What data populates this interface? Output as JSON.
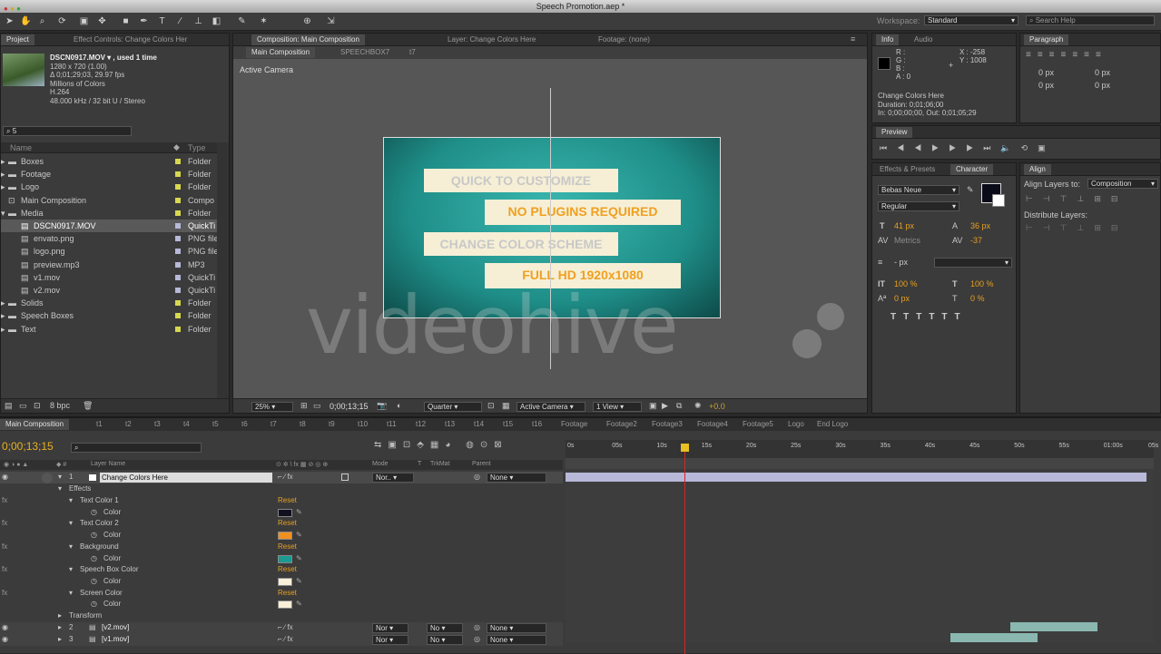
{
  "window": {
    "title": "Speech Promotion.aep *"
  },
  "workspace": {
    "label": "Workspace:",
    "value": "Standard",
    "search_placeholder": "Search Help"
  },
  "project": {
    "tabs": [
      "Project",
      "Effect Controls: Change Colors Her"
    ],
    "footage": {
      "name": "DSCN0917.MOV ▾ , used 1 time",
      "details": [
        "1280 x 720 (1.00)",
        "Δ 0;01;29;03, 29.97 fps",
        "Millions of Colors",
        "H.264",
        "48.000 kHz / 32 bit U / Stereo"
      ]
    },
    "search_value": "5",
    "columns": {
      "name": "Name",
      "type": "Type"
    },
    "items": [
      {
        "name": "Boxes",
        "type": "Folder",
        "icon": "folder",
        "color": "#d8d850",
        "expand": "▸",
        "indent": 0
      },
      {
        "name": "Footage",
        "type": "Folder",
        "icon": "folder",
        "color": "#d8d850",
        "expand": "▸",
        "indent": 0
      },
      {
        "name": "Logo",
        "type": "Folder",
        "icon": "folder",
        "color": "#d8d850",
        "expand": "▸",
        "indent": 0
      },
      {
        "name": "Main Composition",
        "type": "Compo",
        "icon": "comp",
        "color": "#d8d850",
        "expand": "",
        "indent": 0
      },
      {
        "name": "Media",
        "type": "Folder",
        "icon": "folder",
        "color": "#d8d850",
        "expand": "▾",
        "indent": 0
      },
      {
        "name": "DSCN0917.MOV",
        "type": "QuickTi",
        "icon": "file",
        "color": "#b8b8d8",
        "expand": "",
        "indent": 1,
        "selected": true
      },
      {
        "name": "envato.png",
        "type": "PNG file",
        "icon": "file",
        "color": "#b8b8d8",
        "expand": "",
        "indent": 1
      },
      {
        "name": "logo.png",
        "type": "PNG file",
        "icon": "file",
        "color": "#b8b8d8",
        "expand": "",
        "indent": 1
      },
      {
        "name": "preview.mp3",
        "type": "MP3",
        "icon": "file",
        "color": "#b8b8d8",
        "expand": "",
        "indent": 1
      },
      {
        "name": "v1.mov",
        "type": "QuickTi",
        "icon": "file",
        "color": "#b8b8d8",
        "expand": "",
        "indent": 1
      },
      {
        "name": "v2.mov",
        "type": "QuickTi",
        "icon": "file",
        "color": "#b8b8d8",
        "expand": "",
        "indent": 1
      },
      {
        "name": "Solids",
        "type": "Folder",
        "icon": "folder",
        "color": "#d8d850",
        "expand": "▸",
        "indent": 0
      },
      {
        "name": "Speech Boxes",
        "type": "Folder",
        "icon": "folder",
        "color": "#d8d850",
        "expand": "▸",
        "indent": 0
      },
      {
        "name": "Text",
        "type": "Folder",
        "icon": "folder",
        "color": "#d8d850",
        "expand": "▸",
        "indent": 0
      }
    ],
    "bpc": "8 bpc"
  },
  "composition": {
    "tabs": [
      "Composition: Main Composition",
      "Layer: Change Colors Here",
      "Footage: (none)"
    ],
    "breadcrumbs": [
      "Main Composition",
      "SPEECHBOX7",
      "t7"
    ],
    "camera_label": "Active Camera",
    "bubbles": [
      {
        "text": "QUICK TO CUSTOMIZE",
        "color": "#1a1a1a"
      },
      {
        "text": "NO PLUGINS REQUIRED",
        "color": "#f0a020"
      },
      {
        "text": "CHANGE COLOR SCHEME",
        "color": "#1a1a1a"
      },
      {
        "text": "FULL HD 1920x1080",
        "color": "#f0a020"
      }
    ],
    "watermark": "videohive",
    "footer": {
      "zoom": "25%",
      "timecode": "0;00;13;15",
      "resolution": "Quarter",
      "camera": "Active Camera",
      "views": "1 View",
      "exposure": "+0.0"
    }
  },
  "info": {
    "tabs": [
      "Info",
      "Audio"
    ],
    "r": "R :",
    "g": "G :",
    "b": "B :",
    "a": "A : 0",
    "x": "X : -258",
    "y": "Y : 1008",
    "layer": "Change Colors Here",
    "duration": "Duration: 0;01;06;00",
    "in_out": "In: 0;00;00;00, Out: 0;01;05;29"
  },
  "paragraph": {
    "tab": "Paragraph",
    "values": [
      "0 px",
      "0 px",
      "0 px",
      "0 px",
      "0 px"
    ]
  },
  "preview": {
    "tab": "Preview",
    "controls": [
      "⏮",
      "◀◀",
      "▶",
      "▶▶",
      "⏭",
      "🔈",
      "⟲",
      "▣"
    ]
  },
  "character": {
    "tabs": [
      "Effects & Presets",
      "Character"
    ],
    "font": "Bebas Neue",
    "style": "Regular",
    "size": "41 px",
    "leading": "36 px",
    "kerning": "Metrics",
    "tracking": "-37",
    "stroke": "- px",
    "vscale": "100 %",
    "hscale": "100 %",
    "baseline": "0 px",
    "tsume": "0 %",
    "fill_color": "#0a0a18"
  },
  "align": {
    "tab": "Align",
    "label": "Align Layers to:",
    "value": "Composition",
    "distribute": "Distribute Layers:"
  },
  "timeline": {
    "tabs": [
      "Main Composition",
      "t1",
      "t2",
      "t3",
      "t4",
      "t5",
      "t6",
      "t7",
      "t8",
      "t9",
      "t10",
      "t11",
      "t12",
      "t13",
      "t14",
      "t15",
      "t16",
      "Footage",
      "Footage2",
      "Footage3",
      "Footage4",
      "Footage5",
      "Logo",
      "End Logo"
    ],
    "timecode": "0;00;13;15",
    "columns": {
      "layer_name": "Layer Name",
      "mode": "Mode",
      "trkmat": "TrkMat",
      "parent": "Parent"
    },
    "ruler": [
      "0s",
      "05s",
      "10s",
      "15s",
      "20s",
      "25s",
      "30s",
      "35s",
      "40s",
      "45s",
      "50s",
      "55s",
      "01:00s",
      "05s"
    ],
    "layer1": {
      "num": "1",
      "name": "Change Colors Here",
      "mode": "Nor..",
      "parent": "None"
    },
    "effects_label": "Effects",
    "effect_groups": [
      {
        "name": "Text Color 1",
        "reset": "Reset",
        "swatch": "#101020"
      },
      {
        "name": "Text Color 2",
        "reset": "Reset",
        "swatch": "#f09020"
      },
      {
        "name": "Background",
        "reset": "Reset",
        "swatch": "#1a9a90"
      },
      {
        "name": "Speech Box Color",
        "reset": "Reset",
        "swatch": "#f8f0d8"
      },
      {
        "name": "Screen Color",
        "reset": "Reset",
        "swatch": "#f8f0d8"
      }
    ],
    "color_label": "Color",
    "transform_label": "Transform",
    "layer2": {
      "num": "2",
      "name": "[v2.mov]",
      "mode": "Nor",
      "trkmat": "No",
      "parent": "None"
    },
    "layer3": {
      "num": "3",
      "name": "[v1.mov]",
      "mode": "Nor",
      "trkmat": "No",
      "parent": "None"
    }
  }
}
